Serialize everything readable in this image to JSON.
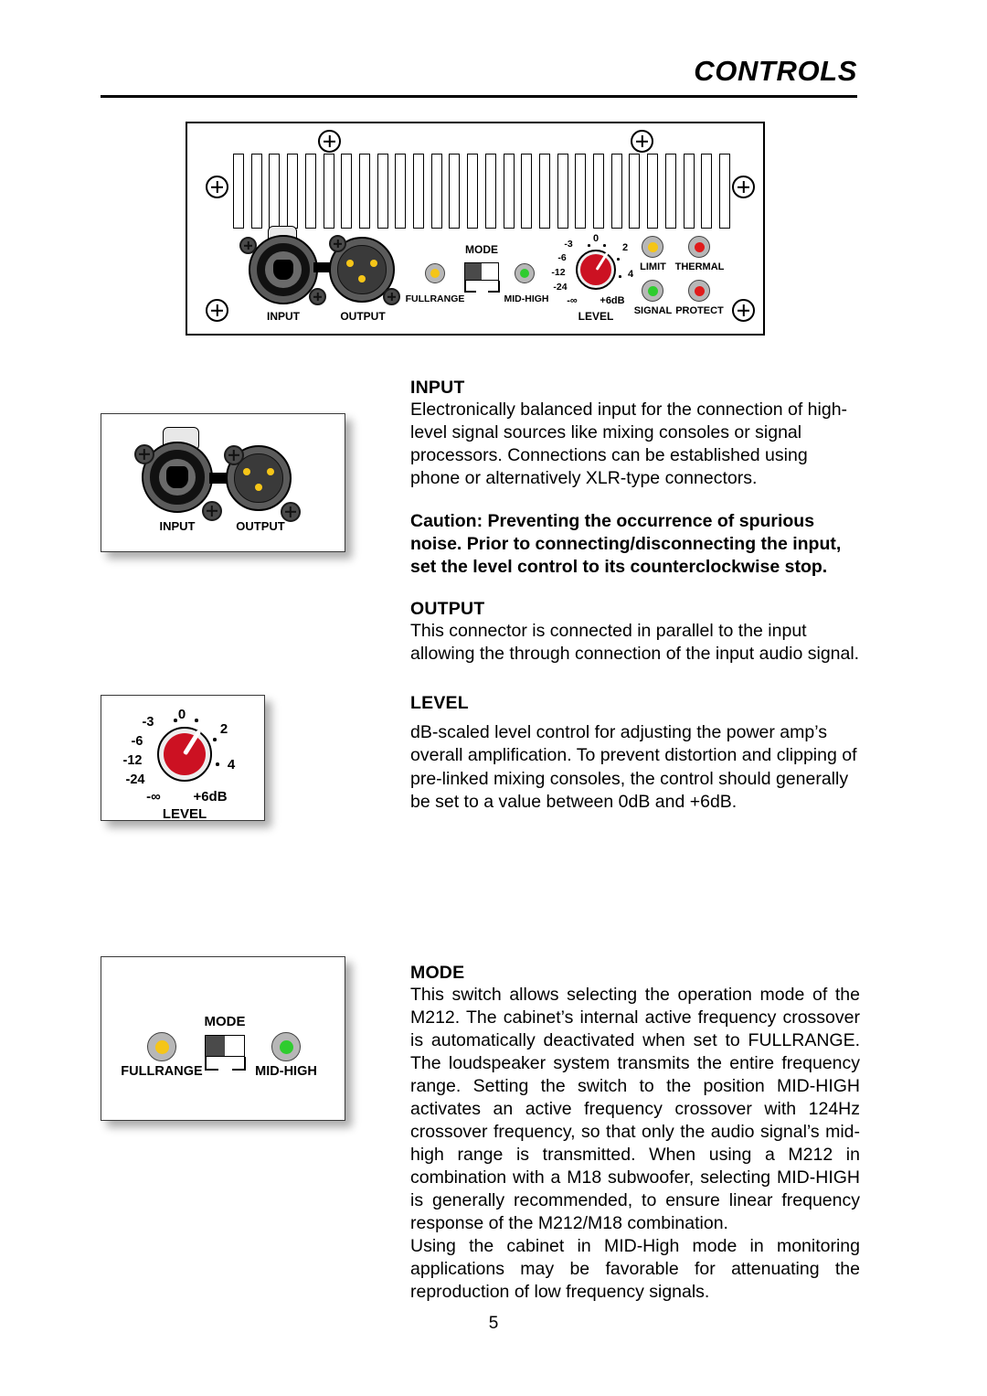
{
  "header": {
    "title": "CONTROLS"
  },
  "panel": {
    "connectors": [
      {
        "name": "input",
        "label": "INPUT"
      },
      {
        "name": "output",
        "label": "OUTPUT"
      }
    ],
    "mode_switch": {
      "title": "MODE",
      "left_label": "FULLRANGE",
      "right_label": "MID-HIGH",
      "position": "left"
    },
    "level_knob": {
      "caption": "LEVEL",
      "scale": [
        "-∞",
        "-24",
        "-12",
        "-6",
        "-3",
        "0",
        "2",
        "4",
        "+6dB"
      ]
    },
    "indicators": [
      {
        "name": "limit",
        "label": "LIMIT",
        "color": "#f5c518"
      },
      {
        "name": "thermal",
        "label": "THERMAL",
        "color": "#e01b1b"
      },
      {
        "name": "signal",
        "label": "SIGNAL",
        "color": "#2fcc2f"
      },
      {
        "name": "protect",
        "label": "PROTECT",
        "color": "#e01b1b"
      }
    ]
  },
  "figures": {
    "connectors": {
      "input_label": "INPUT",
      "output_label": "OUTPUT"
    },
    "level": {
      "caption": "LEVEL",
      "scale": [
        "-∞",
        "-24",
        "-12",
        "-6",
        "-3",
        "0",
        "2",
        "4",
        "+6dB"
      ]
    },
    "mode": {
      "title": "MODE",
      "left_label": "FULLRANGE",
      "right_label": "MID-HIGH"
    }
  },
  "sections": {
    "input": {
      "heading": "INPUT",
      "body": "Electronically balanced input for the connection of high-level signal sources like mixing consoles or signal processors. Connections can be established using phone or alternatively XLR-type connectors.",
      "caution": "Caution: Preventing the occurrence of spurious noise. Prior to connecting/disconnecting the input, set the level control to its counterclockwise stop."
    },
    "output": {
      "heading": "OUTPUT",
      "body": "This connector is connected in parallel to the input allowing the through connection of the input audio signal."
    },
    "level": {
      "heading": "LEVEL",
      "body": "dB-scaled level control for adjusting the power amp’s overall amplification. To prevent distortion and clipping of pre-linked mixing consoles, the control should generally be set to a value between 0dB and +6dB."
    },
    "mode": {
      "heading": "MODE",
      "body1": "This switch allows selecting the operation mode of the M212. The cabinet’s internal active frequency crossover is automatically deactivated when set to FULLRANGE. The loudspeaker system transmits the entire frequency range. Setting the switch to the position MID-HIGH activates an active frequency crossover with 124Hz crossover frequency, so that only the audio signal’s mid-high range is transmitted. When using a M212 in combination with a M18 subwoofer, selecting MID-HIGH is generally recommended, to ensure linear frequency response of the M212/M18 combination.",
      "body2": "Using the cabinet in MID-High mode in monitoring applications may be favorable for attenuating the reproduction of low frequency signals."
    }
  },
  "footer": {
    "page_number": "5"
  }
}
